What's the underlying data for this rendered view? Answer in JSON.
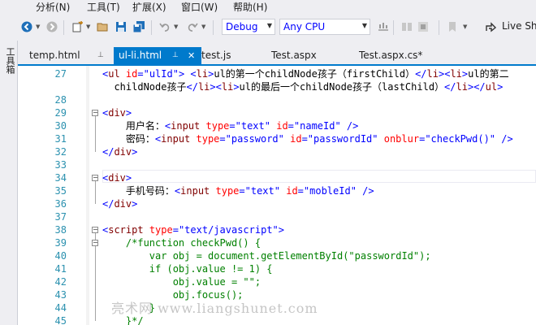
{
  "menu": {
    "items": [
      "分析(N)",
      "工具(T)",
      "扩展(X)",
      "窗口(W)",
      "帮助(H)"
    ]
  },
  "toolbar": {
    "config": "Debug",
    "platform": "Any CPU",
    "live_share": "Live Sh"
  },
  "left_strip": {
    "toolbox": "工具箱"
  },
  "tabs": [
    {
      "label": "temp.html",
      "active": false
    },
    {
      "label": "ul-li.html",
      "active": true
    },
    {
      "label": "test.js",
      "active": false
    },
    {
      "label": "Test.aspx",
      "active": false
    },
    {
      "label": "Test.aspx.cs*",
      "active": false
    }
  ],
  "editor": {
    "lines": [
      {
        "n": "27",
        "text": "<ul id=\"ulId\"> <li>ul的第一个childNode孩子（firstChild）</li><li>ul的第二"
      },
      {
        "n": "",
        "text": "  childNode孩子</li><li>ul的最后一个childNode孩子（lastChild）</li></ul>"
      },
      {
        "n": "28",
        "text": ""
      },
      {
        "n": "29",
        "text": "<div>"
      },
      {
        "n": "30",
        "text": "    用户名：<input type=\"text\" id=\"nameId\" />"
      },
      {
        "n": "31",
        "text": "    密码：<input type=\"password\" id=\"passwordId\" onblur=\"checkPwd()\" />"
      },
      {
        "n": "32",
        "text": "</div>"
      },
      {
        "n": "33",
        "text": ""
      },
      {
        "n": "34",
        "text": "<div>"
      },
      {
        "n": "35",
        "text": "    手机号码：<input type=\"text\" id=\"mobleId\" />"
      },
      {
        "n": "36",
        "text": "</div>"
      },
      {
        "n": "37",
        "text": ""
      },
      {
        "n": "38",
        "text": "<script type=\"text/javascript\">"
      },
      {
        "n": "39",
        "text": "    /*function checkPwd() {"
      },
      {
        "n": "40",
        "text": "        var obj = document.getElementById(\"passwordId\");"
      },
      {
        "n": "41",
        "text": "        if (obj.value != 1) {"
      },
      {
        "n": "42",
        "text": "            obj.value = \"\";"
      },
      {
        "n": "43",
        "text": "            obj.focus();"
      },
      {
        "n": "44",
        "text": "        }"
      },
      {
        "n": "45",
        "text": "    }*/"
      }
    ]
  },
  "watermark": "亮术网 www.liangshunet.com",
  "colors": {
    "accent": "#007acc",
    "line_number": "#2b91af",
    "html_tag": "#800000",
    "html_attr": "#ff0000",
    "html_value": "#0000ff",
    "comment": "#008000"
  }
}
